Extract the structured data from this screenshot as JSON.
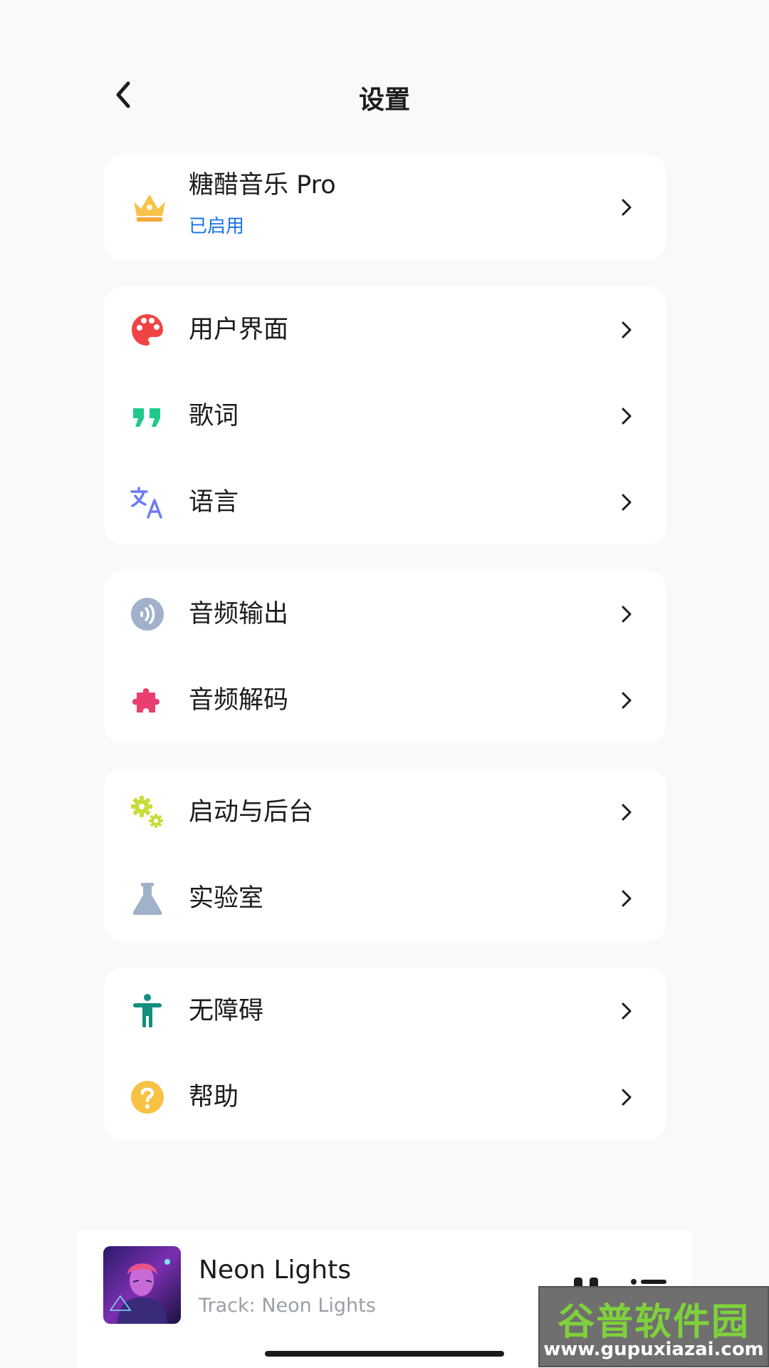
{
  "header": {
    "title": "设置"
  },
  "pro": {
    "label": "糖醋音乐 Pro",
    "status": "已启用"
  },
  "groups": [
    {
      "items": [
        {
          "label": "用户界面",
          "icon": "palette-icon",
          "color": "#f04444"
        },
        {
          "label": "歌词",
          "icon": "quote-icon",
          "color": "#1ec98b"
        },
        {
          "label": "语言",
          "icon": "translate-icon",
          "color": "#6b7cf0"
        }
      ]
    },
    {
      "items": [
        {
          "label": "音频输出",
          "icon": "audio-output-icon",
          "color": "#9fb2c9"
        },
        {
          "label": "音频解码",
          "icon": "puzzle-icon",
          "color": "#e83e72"
        }
      ]
    },
    {
      "items": [
        {
          "label": "启动与后台",
          "icon": "gears-icon",
          "color": "#c9dc3a"
        },
        {
          "label": "实验室",
          "icon": "flask-icon",
          "color": "#9fb2c9"
        }
      ]
    },
    {
      "items": [
        {
          "label": "无障碍",
          "icon": "accessibility-icon",
          "color": "#128f7e"
        },
        {
          "label": "帮助",
          "icon": "help-icon",
          "color": "#f7c244"
        }
      ]
    }
  ],
  "player": {
    "title": "Neon Lights",
    "subtitle": "Track: Neon Lights"
  },
  "watermark": {
    "main": "谷普软件园",
    "sub": "www.gupuxiazai.com"
  }
}
